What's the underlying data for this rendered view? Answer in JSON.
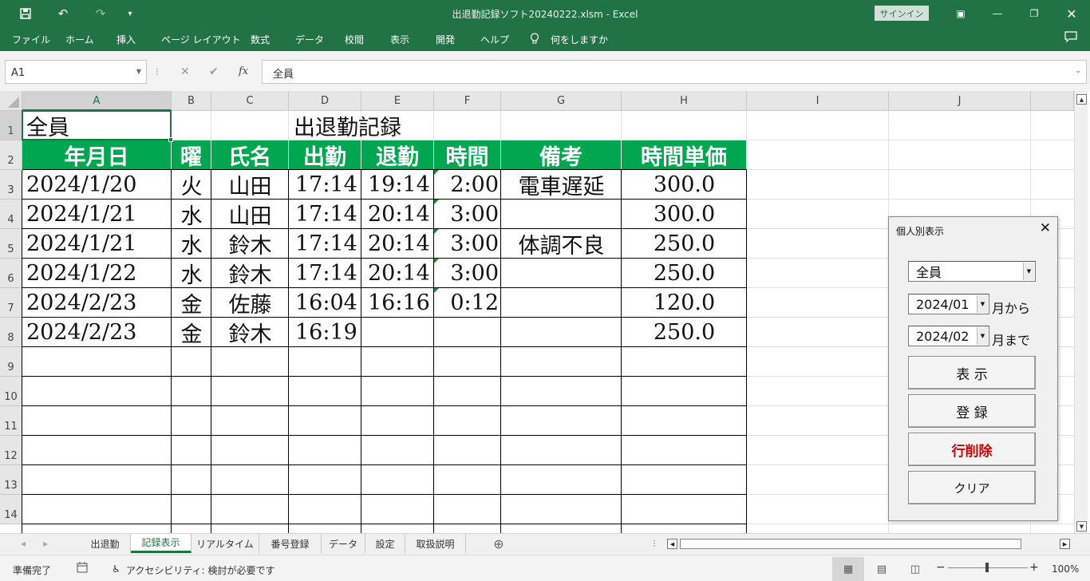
{
  "window": {
    "title": "出退勤記録ソフト20240222.xlsm  -  Excel",
    "signin": "サインイン"
  },
  "ribbon": {
    "tabs": [
      "ファイル",
      "ホーム",
      "挿入",
      "ページ レイアウト",
      "数式",
      "データ",
      "校閲",
      "表示",
      "開発",
      "ヘルプ"
    ],
    "tell_me": "何をしますか"
  },
  "formula_bar": {
    "name_box": "A1",
    "fx": "fx",
    "content": "全員"
  },
  "columns": [
    "A",
    "B",
    "C",
    "D",
    "E",
    "F",
    "G",
    "H",
    "I",
    "J"
  ],
  "rows": [
    "1",
    "2",
    "3",
    "4",
    "5",
    "6",
    "7",
    "8",
    "9",
    "10",
    "11",
    "12",
    "13",
    "14"
  ],
  "sheet": {
    "a1": "全員",
    "title": "出退勤記録",
    "headers": [
      "年月日",
      "曜",
      "氏名",
      "出勤",
      "退勤",
      "時間",
      "備考",
      "時間単価"
    ],
    "records": [
      [
        "2024/1/20",
        "火",
        "山田",
        "17:14",
        "19:14",
        "2:00",
        "電車遅延",
        "300.0"
      ],
      [
        "2024/1/21",
        "水",
        "山田",
        "17:14",
        "20:14",
        "3:00",
        "",
        "300.0"
      ],
      [
        "2024/1/21",
        "水",
        "鈴木",
        "17:14",
        "20:14",
        "3:00",
        "体調不良",
        "250.0"
      ],
      [
        "2024/1/22",
        "水",
        "鈴木",
        "17:14",
        "20:14",
        "3:00",
        "",
        "250.0"
      ],
      [
        "2024/2/23",
        "金",
        "佐藤",
        "16:04",
        "16:16",
        "0:12",
        "",
        "120.0"
      ],
      [
        "2024/2/23",
        "金",
        "鈴木",
        "16:19",
        "",
        "",
        "",
        "250.0"
      ]
    ]
  },
  "dialog": {
    "title": "個人別表示",
    "person_value": "全員",
    "from_month": "2024/01",
    "from_suffix": "月から",
    "to_month": "2024/02",
    "to_suffix": "月まで",
    "show_button": "表 示",
    "register_button": "登 録",
    "delete_button": "行削除",
    "clear_button": "クリア",
    "delete_color": "#cc0000"
  },
  "sheet_tabs": [
    "出退勤",
    "記録表示",
    "リアルタイム",
    "番号登録",
    "データ",
    "設定",
    "取扱説明"
  ],
  "active_sheet_tab": "記録表示",
  "status": {
    "ready": "準備完了",
    "accessibility": "アクセシビリティ: 検討が必要です",
    "zoom": "100%"
  },
  "colors": {
    "excel_green": "#217346",
    "header_fill": "#00a650"
  }
}
